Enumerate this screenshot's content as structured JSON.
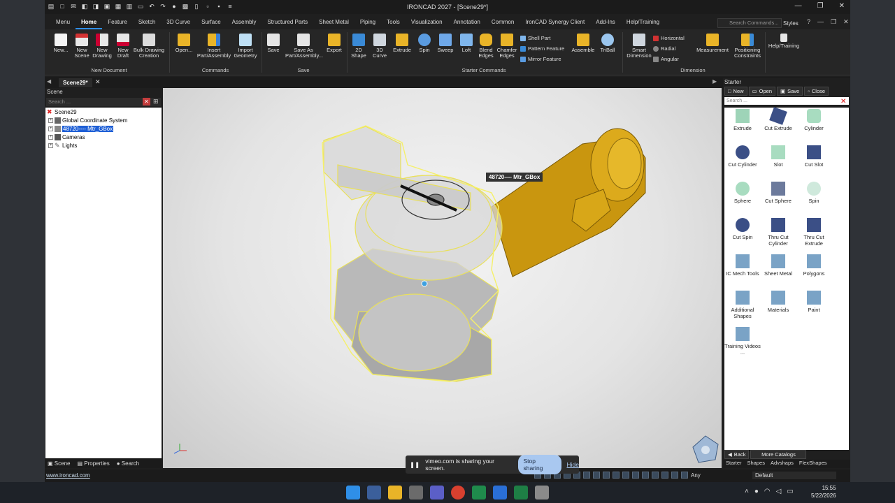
{
  "window": {
    "title": "IRONCAD 2027 - [Scene29*]",
    "controls": [
      "minimize-icon",
      "restore-icon",
      "close-icon"
    ]
  },
  "ribbon_tabs": [
    "Menu",
    "Home",
    "Feature",
    "Sketch",
    "3D Curve",
    "Surface",
    "Assembly",
    "Structured Parts",
    "Sheet Metal",
    "Piping",
    "Tools",
    "Visualization",
    "Annotation",
    "Common",
    "IronCAD Synergy Client",
    "Add-Ins",
    "Help/Training"
  ],
  "active_tab": "Home",
  "search_commands_placeholder": "Search Commands...",
  "styles_label": "Styles",
  "ribbon": {
    "new_document": {
      "group": "New Document",
      "buttons": [
        "New...",
        "New Scene",
        "New Drawing",
        "New Draft",
        "Bulk Drawing Creation"
      ]
    },
    "commands": {
      "group": "Commands",
      "buttons": [
        "Open...",
        "Insert Part/Assembly",
        "Import Geometry"
      ]
    },
    "save": {
      "group": "Save",
      "buttons": [
        "Save",
        "Save As Part/Assembly...",
        "Export"
      ]
    },
    "starter_commands": {
      "group": "Starter Commands",
      "buttons": [
        "2D Shape",
        "3D Curve",
        "Extrude",
        "Spin",
        "Sweep",
        "Loft",
        "Blend Edges",
        "Chamfer Edges"
      ],
      "small": [
        "Shell Part",
        "Pattern Feature",
        "Mirror Feature"
      ],
      "extra": [
        "Assemble",
        "TriBall"
      ]
    },
    "dimension": {
      "group": "Dimension",
      "buttons": [
        "Smart Dimension"
      ],
      "small": [
        "Horizontal",
        "Radial",
        "Angular"
      ],
      "extra": [
        "Measurement",
        "Positioning Constraints"
      ]
    },
    "help": {
      "buttons": [
        "Help/Training"
      ]
    }
  },
  "doc_tab": "Scene29*",
  "scene_panel": {
    "title": "Scene",
    "search_placeholder": "Search ...",
    "tree": [
      "Scene29",
      "Global Coordinate System",
      "48720---- Mtr_GBox",
      "Cameras",
      "Lights"
    ],
    "bottom_tabs": [
      "Scene",
      "Properties",
      "Search"
    ]
  },
  "viewport": {
    "tooltip": "48720---- Mtr_GBox"
  },
  "starter_panel": {
    "title": "Starter",
    "toolbar": [
      "New",
      "Open",
      "Save",
      "Close"
    ],
    "search_placeholder": "Search ...",
    "items": [
      "Extrude",
      "Cut Extrude",
      "Cylinder",
      "Cut Cylinder",
      "Slot",
      "Cut Slot",
      "Sphere",
      "Cut Sphere",
      "Spin",
      "Cut Spin",
      "Thru Cut Cylinder",
      "Thru Cut Extrude",
      "IC Mech Tools",
      "Sheet Metal",
      "Polygons",
      "Additional Shapes",
      "Materials",
      "Paint",
      "Training Videos ..."
    ],
    "back_label": "Back",
    "more_label": "More Catalogs",
    "tabs": [
      "Starter",
      "Shapes",
      "Advshaps",
      "FlexShapes"
    ]
  },
  "statusbar": {
    "url": "www.ironcad.com",
    "filter": "Any",
    "style": "Default"
  },
  "share_bar": {
    "message": "vimeo.com is sharing your screen.",
    "stop": "Stop sharing",
    "hide": "Hide"
  },
  "clock": {
    "time": "15:55",
    "date": "5/22/2026"
  },
  "colors": {
    "accent": "#2f8fe8",
    "model_gold": "#d4a017",
    "selection_yellow": "#f5f06a",
    "tree_selection": "#1e5fd6"
  }
}
